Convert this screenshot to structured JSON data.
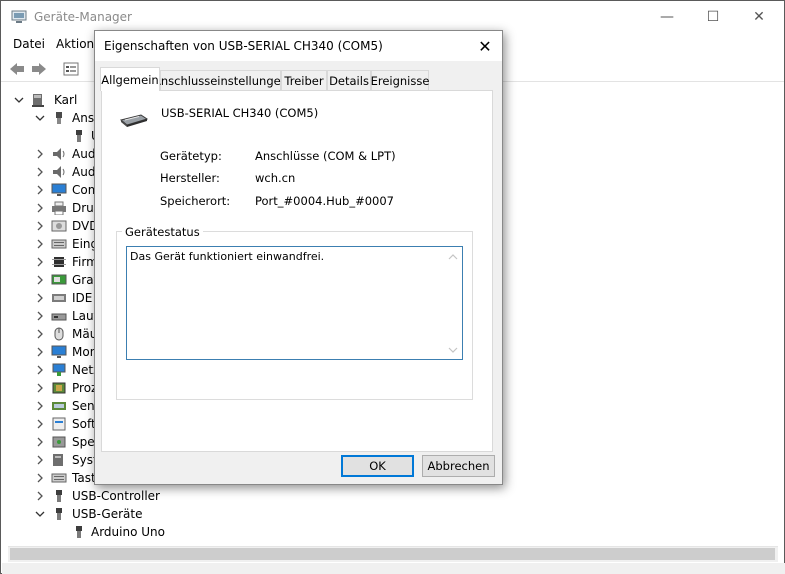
{
  "main_window": {
    "title": "Geräte-Manager",
    "controls": {
      "minimize": "—",
      "maximize": "☐",
      "close": "✕"
    },
    "menu": [
      "Datei",
      "Aktion"
    ],
    "tree": [
      {
        "label": "Karl",
        "icon": "computer-icon",
        "expanded": true,
        "level": 0
      },
      {
        "label": "Ansc",
        "icon": "port-icon",
        "expanded": true,
        "level": 1
      },
      {
        "label": "U",
        "icon": "usb-plug-icon",
        "expanded": null,
        "level": 2
      },
      {
        "label": "Audi",
        "icon": "speaker-icon",
        "expanded": false,
        "level": 1
      },
      {
        "label": "Audi",
        "icon": "speaker-icon",
        "expanded": false,
        "level": 1
      },
      {
        "label": "Com",
        "icon": "monitor-icon",
        "expanded": false,
        "level": 1
      },
      {
        "label": "Druc",
        "icon": "printer-icon",
        "expanded": false,
        "level": 1
      },
      {
        "label": "DVD",
        "icon": "dvd-icon",
        "expanded": false,
        "level": 1
      },
      {
        "label": "Eing",
        "icon": "keyboard-icon",
        "expanded": false,
        "level": 1
      },
      {
        "label": "Firm",
        "icon": "chip-icon",
        "expanded": false,
        "level": 1
      },
      {
        "label": "Grafi",
        "icon": "display-adapter-icon",
        "expanded": false,
        "level": 1
      },
      {
        "label": "IDE A",
        "icon": "ide-icon",
        "expanded": false,
        "level": 1
      },
      {
        "label": "Lauf",
        "icon": "drive-icon",
        "expanded": false,
        "level": 1
      },
      {
        "label": "Mäu",
        "icon": "mouse-icon",
        "expanded": false,
        "level": 1
      },
      {
        "label": "Mon",
        "icon": "monitor-icon",
        "expanded": false,
        "level": 1
      },
      {
        "label": "Netz",
        "icon": "network-icon",
        "expanded": false,
        "level": 1
      },
      {
        "label": "Proz",
        "icon": "processor-icon",
        "expanded": false,
        "level": 1
      },
      {
        "label": "Sens",
        "icon": "sensor-icon",
        "expanded": false,
        "level": 1
      },
      {
        "label": "Softv",
        "icon": "software-icon",
        "expanded": false,
        "level": 1
      },
      {
        "label": "Spei",
        "icon": "storage-icon",
        "expanded": false,
        "level": 1
      },
      {
        "label": "Syste",
        "icon": "system-icon",
        "expanded": false,
        "level": 1
      },
      {
        "label": "Tasta",
        "icon": "keyboard-icon",
        "expanded": false,
        "level": 1
      },
      {
        "label": "USB-Controller",
        "icon": "usb-plug-icon",
        "expanded": false,
        "level": 1
      },
      {
        "label": "USB-Geräte",
        "icon": "usb-plug-icon",
        "expanded": true,
        "level": 1
      },
      {
        "label": "Arduino Uno",
        "icon": "usb-plug-icon",
        "expanded": null,
        "level": 2
      }
    ]
  },
  "dialog": {
    "title": "Eigenschaften von USB-SERIAL CH340 (COM5)",
    "tabs": [
      "Allgemein",
      "Anschlusseinstellungen",
      "Treiber",
      "Details",
      "Ereignisse"
    ],
    "active_tab": "Allgemein",
    "device_name": "USB-SERIAL CH340 (COM5)",
    "properties": [
      {
        "label": "Gerätetyp:",
        "value": "Anschlüsse (COM & LPT)"
      },
      {
        "label": "Hersteller:",
        "value": "wch.cn"
      },
      {
        "label": "Speicherort:",
        "value": "Port_#0004.Hub_#0007"
      }
    ],
    "status_group_label": "Gerätestatus",
    "status_text": "Das Gerät funktioniert einwandfrei.",
    "buttons": {
      "ok": "OK",
      "cancel": "Abbrechen"
    }
  },
  "colors": {
    "accent": "#0078d7",
    "focus_border": "#3c7fb1"
  }
}
